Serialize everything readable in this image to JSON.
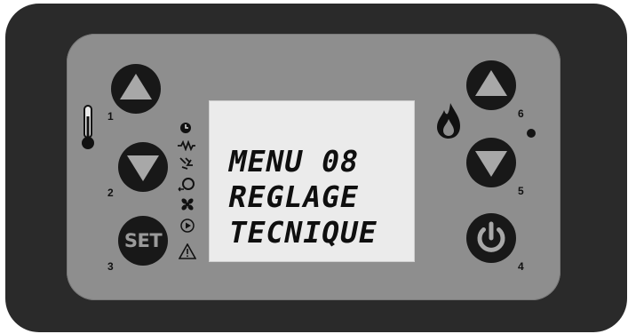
{
  "display": {
    "line1": "MENU 08",
    "line2": "REGLAGE",
    "line3": "TECNIQUE"
  },
  "buttons": {
    "b1": {
      "number": "1",
      "icon": "triangle-up-icon"
    },
    "b2": {
      "number": "2",
      "icon": "triangle-down-icon"
    },
    "b3": {
      "number": "3",
      "label": "SET"
    },
    "b4": {
      "number": "4",
      "icon": "power-icon"
    },
    "b5": {
      "number": "5",
      "icon": "triangle-down-icon"
    },
    "b6": {
      "number": "6",
      "icon": "triangle-up-icon"
    }
  },
  "side_icons": [
    "thermometer-icon",
    "clock-icon",
    "resistor-icon",
    "igniter-icon",
    "pump-icon",
    "fan-icon",
    "play-icon",
    "warning-icon",
    "flame-icon"
  ],
  "colors": {
    "bezel": "#2a2a2a",
    "faceplate": "#8e8e8e",
    "lcd": "#ebebeb",
    "button": "#181818"
  }
}
